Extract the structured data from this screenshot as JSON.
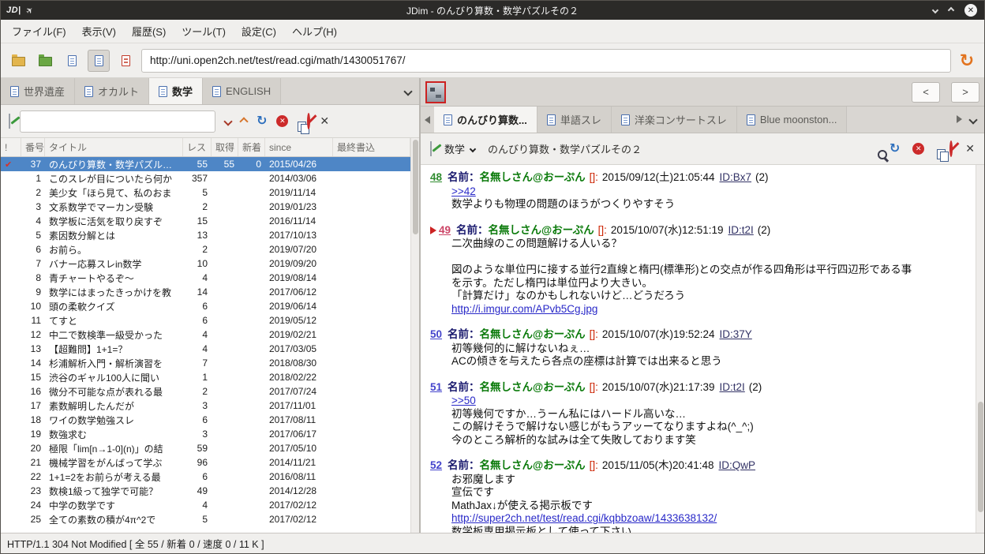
{
  "window": {
    "title": "JDim - のんびり算数・数学パズルその２"
  },
  "menubar": {
    "items": [
      "ファイル(F)",
      "表示(V)",
      "履歴(S)",
      "ツール(T)",
      "設定(C)",
      "ヘルプ(H)"
    ]
  },
  "toolbar": {
    "url": "http://uni.open2ch.net/test/read.cgi/math/1430051767/"
  },
  "colors": {
    "selection_bg": "#4e86c6",
    "link": "#2929c8",
    "post_num_read": "#2e8b2e",
    "post_num_marked": "#cc4466",
    "post_num_link": "#4444cc",
    "name_green": "#0a7a0a",
    "accent_orange": "#e2731e"
  },
  "board_pane": {
    "tabs": [
      {
        "label": "世界遺産",
        "active": false
      },
      {
        "label": "オカルト",
        "active": false
      },
      {
        "label": "数学",
        "active": true
      },
      {
        "label": "ENGLISH",
        "active": false
      }
    ],
    "search_value": "",
    "columns": [
      "!",
      "番号",
      "タイトル",
      "レス",
      "取得",
      "新着",
      "since",
      "最終書込"
    ],
    "rows": [
      {
        "mark": "check",
        "num": "37",
        "title": "のんびり算数・数学パズルその",
        "res": "55",
        "got": "55",
        "new": "0",
        "since": "2015/04/26",
        "selected": true
      },
      {
        "num": "1",
        "title": "このスレが目についたら何か",
        "res": "357",
        "since": "2014/03/06"
      },
      {
        "num": "2",
        "title": "美少女「ほら見て、私のおま",
        "res": "5",
        "since": "2019/11/14"
      },
      {
        "num": "3",
        "title": "文系数学でマーカン受験",
        "res": "2",
        "since": "2019/01/23"
      },
      {
        "num": "4",
        "title": "数学板に活気を取り戻すぞ",
        "res": "15",
        "since": "2016/11/14"
      },
      {
        "num": "5",
        "title": "素因数分解とは",
        "res": "13",
        "since": "2017/10/13"
      },
      {
        "num": "6",
        "title": "お前ら。",
        "res": "2",
        "since": "2019/07/20"
      },
      {
        "num": "7",
        "title": "バナー応募スレin数学",
        "res": "10",
        "since": "2019/09/20"
      },
      {
        "num": "8",
        "title": "青チャートやるぞ〜",
        "res": "4",
        "since": "2019/08/14"
      },
      {
        "num": "9",
        "title": "数学にはまったきっかけを教",
        "res": "14",
        "since": "2017/06/12"
      },
      {
        "num": "10",
        "title": "頭の柔軟クイズ",
        "res": "6",
        "since": "2019/06/14"
      },
      {
        "num": "11",
        "title": "てすと",
        "res": "6",
        "since": "2019/05/12"
      },
      {
        "num": "12",
        "title": "中二で数検準一級受かった",
        "res": "4",
        "since": "2019/02/21"
      },
      {
        "num": "13",
        "title": "【超難問】1+1=？",
        "res": "4",
        "since": "2017/03/05"
      },
      {
        "num": "14",
        "title": "杉浦解析入門・解析演習を",
        "res": "7",
        "since": "2018/08/30"
      },
      {
        "num": "15",
        "title": "渋谷のギャル100人に聞い",
        "res": "1",
        "since": "2018/02/22"
      },
      {
        "num": "16",
        "title": "微分不可能な点が表れる最",
        "res": "2",
        "since": "2017/07/24"
      },
      {
        "num": "17",
        "title": "素数解明したんだが",
        "res": "3",
        "since": "2017/11/01"
      },
      {
        "num": "18",
        "title": "ワイの数学勉強スレ",
        "res": "6",
        "since": "2017/08/11"
      },
      {
        "num": "19",
        "title": "数強求む",
        "res": "3",
        "since": "2017/06/17"
      },
      {
        "num": "20",
        "title": "極限「lim[n→1-0](n)」の結",
        "res": "59",
        "since": "2017/05/10"
      },
      {
        "num": "21",
        "title": "機械学習をがんばって学ぶ",
        "res": "96",
        "since": "2014/11/21"
      },
      {
        "num": "22",
        "title": "1+1=2をお前らが考える最",
        "res": "6",
        "since": "2016/08/11"
      },
      {
        "num": "23",
        "title": "数検1級って独学で可能？",
        "res": "49",
        "since": "2014/12/28"
      },
      {
        "num": "24",
        "title": "中学の数学です",
        "res": "4",
        "since": "2017/02/12"
      },
      {
        "num": "25",
        "title": "全ての素数の積が4π^2で",
        "res": "5",
        "since": "2017/02/12"
      }
    ]
  },
  "thread_pane": {
    "nav": {
      "prev": "<",
      "next": ">"
    },
    "tabs": [
      {
        "label": "のんびり算数...",
        "active": true
      },
      {
        "label": "単語スレ",
        "active": false
      },
      {
        "label": "洋楽コンサートスレ",
        "active": false
      },
      {
        "label": "Blue moonston...",
        "active": false
      }
    ],
    "board_select": "数学",
    "title": "のんびり算数・数学パズルその２",
    "post_name_label": "名前：",
    "post_name": "名無しさん@おーぷん",
    "post_mail": "[]:",
    "posts": [
      {
        "num": "48",
        "num_color": "#2e8b2e",
        "marked": false,
        "date": "2015/09/12(土)21:05:44",
        "id": "ID:Bx7",
        "count": "(2)",
        "lines": [
          {
            "type": "link",
            "text": ">>42"
          },
          {
            "type": "text",
            "text": "数学よりも物理の問題のほうがつくりやすそう"
          }
        ]
      },
      {
        "num": "49",
        "num_color": "#cc4466",
        "marked": true,
        "date": "2015/10/07(水)12:51:19",
        "id": "ID:t2I",
        "count": "(2)",
        "lines": [
          {
            "type": "text",
            "text": "二次曲線のこの問題解ける人いる？"
          },
          {
            "type": "text",
            "text": ""
          },
          {
            "type": "text",
            "text": "図のような単位円に接する並行2直線と楕円(標準形)との交点が作る四角形は平行四辺形である事"
          },
          {
            "type": "text",
            "text": "を示す。ただし楕円は単位円より大きい。"
          },
          {
            "type": "text",
            "text": "「計算だけ」なのかもしれないけど…どうだろう"
          },
          {
            "type": "link",
            "text": "http://i.imgur.com/APvb5Cg.jpg"
          }
        ]
      },
      {
        "num": "50",
        "num_color": "#4444cc",
        "marked": false,
        "date": "2015/10/07(水)19:52:24",
        "id": "ID:37Y",
        "count": "",
        "lines": [
          {
            "type": "text",
            "text": "初等幾何的に解けないねぇ…"
          },
          {
            "type": "text",
            "text": "ACの傾きを与えたら各点の座標は計算では出来ると思う"
          }
        ]
      },
      {
        "num": "51",
        "num_color": "#4444cc",
        "marked": false,
        "date": "2015/10/07(水)21:17:39",
        "id": "ID:t2I",
        "count": "(2)",
        "lines": [
          {
            "type": "link",
            "text": ">>50"
          },
          {
            "type": "text",
            "text": "初等幾何ですか…うーん私にはハードル高いな…"
          },
          {
            "type": "text",
            "text": "この解けそうで解けない感じがもうアッーてなりますよね(^_^;)"
          },
          {
            "type": "text",
            "text": "今のところ解析的な試みは全て失敗しております笑"
          }
        ]
      },
      {
        "num": "52",
        "num_color": "#4444cc",
        "marked": false,
        "date": "2015/11/05(木)20:41:48",
        "id": "ID:QwP",
        "count": "",
        "lines": [
          {
            "type": "text",
            "text": "お邪魔します"
          },
          {
            "type": "text",
            "text": "宣伝です"
          },
          {
            "type": "text",
            "text": "MathJax↓が使える掲示板です"
          },
          {
            "type": "link",
            "text": "http://super2ch.net/test/read.cgi/kqbbzoaw/1433638132/"
          },
          {
            "type": "text",
            "text": "数学板専用掲示板として使って下さい"
          }
        ]
      }
    ]
  },
  "statusbar": {
    "text": "HTTP/1.1 304 Not Modified [ 全 55 / 新着 0 / 速度 0 / 11 K ]"
  }
}
